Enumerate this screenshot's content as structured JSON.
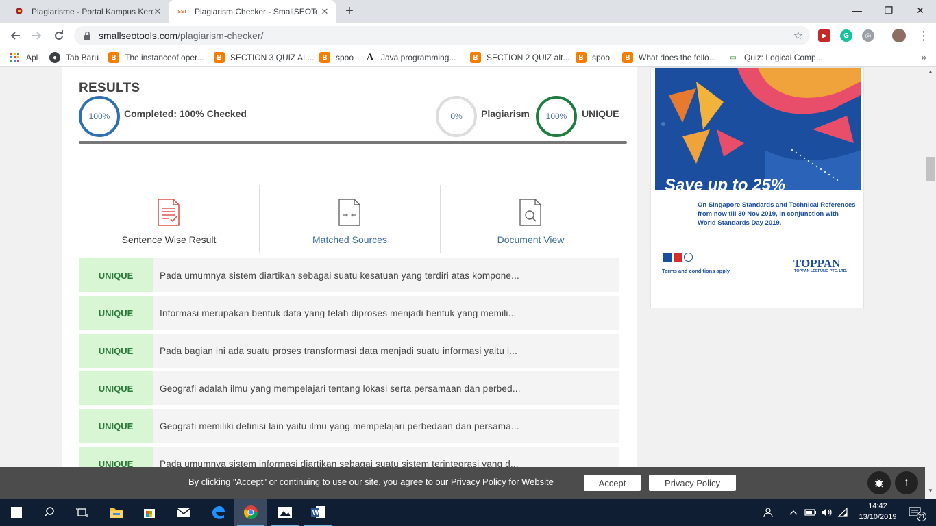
{
  "browser": {
    "tabs": [
      {
        "title": "Plagiarisme - Portal Kampus Kere",
        "close": "✕"
      },
      {
        "title": "Plagiarism Checker - SmallSEOTo",
        "favicon": "SST",
        "close": "✕"
      }
    ],
    "new_tab": "+",
    "window_controls": {
      "minimize": "—",
      "maximize": "❐",
      "close": "✕"
    },
    "url_domain": "smallseotools.com",
    "url_path": "/plagiarism-checker/",
    "bookmarks": [
      {
        "label": "Apl"
      },
      {
        "label": "Tab Baru"
      },
      {
        "label": "The instanceof oper..."
      },
      {
        "label": "SECTION 3 QUIZ AL..."
      },
      {
        "label": "spoo"
      },
      {
        "label": "Java programming..."
      },
      {
        "label": "SECTION 2 QUIZ alt..."
      },
      {
        "label": "spoo"
      },
      {
        "label": "What does the follo..."
      },
      {
        "label": "Quiz: Logical Comp..."
      }
    ],
    "bookmarks_more": "»"
  },
  "results": {
    "title": "RESULTS",
    "completed_percent": "100%",
    "completed_label": "Completed: 100% Checked",
    "plagiarism_percent": "0%",
    "plagiarism_label": "Plagiarism",
    "unique_percent": "100%",
    "unique_label": "UNIQUE",
    "progress_fraction": 1.0
  },
  "result_tabs": [
    {
      "label": "Sentence Wise Result"
    },
    {
      "label": "Matched Sources"
    },
    {
      "label": "Document View"
    }
  ],
  "sentences": [
    {
      "status": "UNIQUE",
      "text": "Pada umumnya sistem diartikan sebagai suatu kesatuan yang terdiri atas kompone..."
    },
    {
      "status": "UNIQUE",
      "text": "Informasi merupakan bentuk data yang telah diproses menjadi bentuk yang memili..."
    },
    {
      "status": "UNIQUE",
      "text": "Pada bagian ini ada suatu proses transformasi data menjadi suatu informasi yaitu i..."
    },
    {
      "status": "UNIQUE",
      "text": "Geografi adalah ilmu yang mempelajari tentang lokasi serta persamaan dan perbed..."
    },
    {
      "status": "UNIQUE",
      "text": "Geografi memiliki definisi lain yaitu ilmu yang mempelajari perbedaan dan persama..."
    },
    {
      "status": "UNIQUE",
      "text": "Pada umumnya sistem informasi diartikan sebagai suatu sistem terintegrasi yang d..."
    }
  ],
  "ad": {
    "headline": "Save up to 25%",
    "subtext": "On Singapore Standards and Technical References from now till 30 Nov 2019, in conjunction with World Standards Day 2019.",
    "terms": "Terms and conditions apply.",
    "brand": "TOPPAN",
    "brand_sub": "TOPPAN LEEFUNG PTE. LTD."
  },
  "cookie_bar": {
    "text": "By clicking \"Accept\" or continuing to use our site, you agree to our Privacy Policy for Website",
    "accept": "Accept",
    "privacy": "Privacy Policy",
    "top_arrow": "↑"
  },
  "taskbar": {
    "time": "14:42",
    "date": "13/10/2019",
    "notifications": "21"
  }
}
